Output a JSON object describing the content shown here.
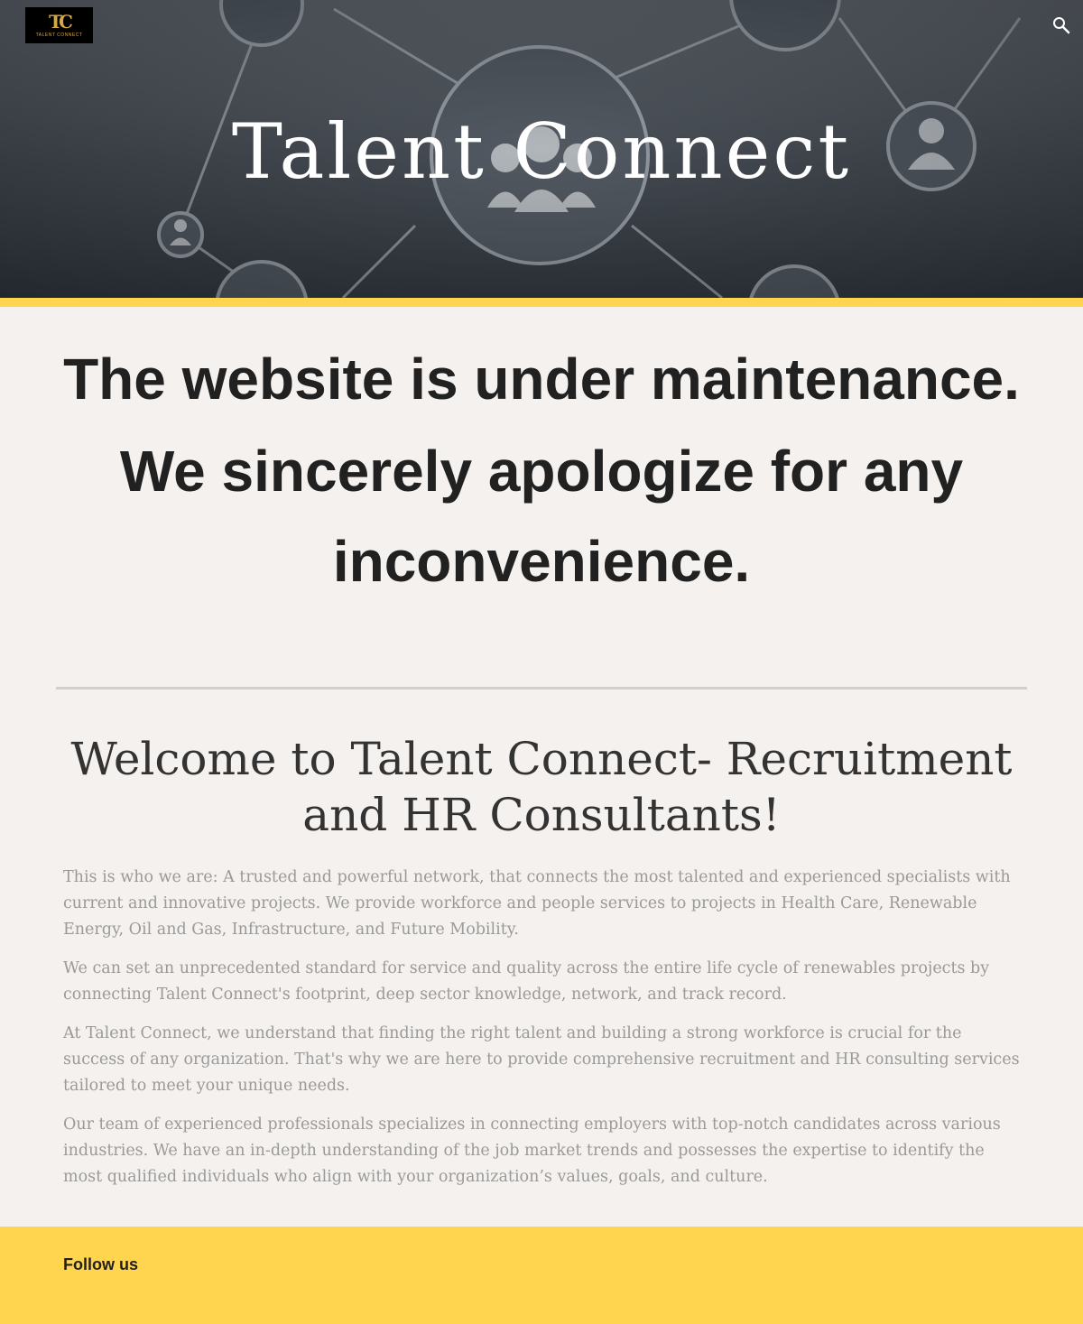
{
  "header": {
    "logo": {
      "mark": "TC",
      "text": "TALENT CONNECT",
      "color": "#d5a84a"
    },
    "search_icon": "search-icon",
    "title": "Talent Connect",
    "accent_color": "#ffd54f"
  },
  "maintenance": {
    "line1": "The website is under maintenance.",
    "line2": "We sincerely apologize for any inconvenience."
  },
  "welcome": {
    "heading": "Welcome to Talent Connect- Recruitment and HR Consultants!",
    "paragraphs": [
      "This is who we are: A trusted and powerful network, that connects the most talented and experienced specialists with current and innovative projects. We provide workforce and people services to projects in Health Care, Renewable Energy, Oil and Gas, Infrastructure, and Future Mobility.",
      "We can set an unprecedented standard for service and quality across the entire life cycle of renewables projects by connecting Talent Connect's footprint, deep sector knowledge, network, and track record.",
      "At Talent Connect, we understand that finding the right talent and building a strong workforce is crucial for the success of any organization. That's why we are here to provide comprehensive recruitment and HR consulting services tailored to meet your unique needs.",
      "Our team of experienced professionals specializes in connecting employers with top-notch candidates across various industries. We have an in-depth understanding of the job market trends and possesses the expertise to identify the most qualified individuals who align with your organization’s values, goals, and culture."
    ]
  },
  "footer": {
    "follow_label": "Follow us",
    "background_color": "#ffd54f"
  }
}
